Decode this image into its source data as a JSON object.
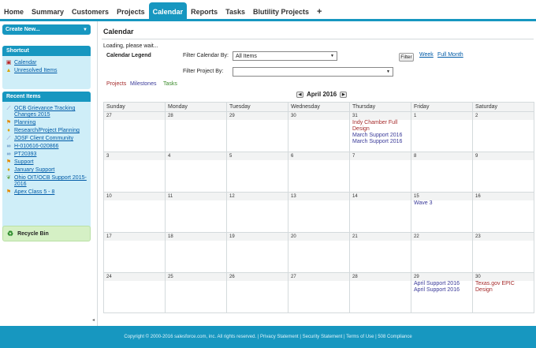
{
  "tabs": [
    {
      "label": "Home",
      "active": false
    },
    {
      "label": "Summary",
      "active": false
    },
    {
      "label": "Customers",
      "active": false
    },
    {
      "label": "Projects",
      "active": false
    },
    {
      "label": "Calendar",
      "active": true
    },
    {
      "label": "Reports",
      "active": false
    },
    {
      "label": "Tasks",
      "active": false
    },
    {
      "label": "Blutility Projects",
      "active": false
    },
    {
      "label": "+",
      "active": false
    }
  ],
  "sidebar": {
    "create_label": "Create New...",
    "shortcut": {
      "title": "Shortcut",
      "items": [
        {
          "label": "Calendar",
          "icon": "calendar-icon"
        },
        {
          "label": "Unresolved Items",
          "icon": "warning-icon"
        }
      ]
    },
    "recent": {
      "title": "Recent Items",
      "items": [
        {
          "label": "OCB Grievance Tracking Changes 2015",
          "icon": "wand-icon"
        },
        {
          "label": "Planning",
          "icon": "flag-icon"
        },
        {
          "label": "Research/Project Planning",
          "icon": "trophy-icon"
        },
        {
          "label": "JOSF Client Community",
          "icon": "wand-icon"
        },
        {
          "label": "H-010616-020866",
          "icon": "link-icon"
        },
        {
          "label": "PT20393",
          "icon": "link-icon"
        },
        {
          "label": "Support",
          "icon": "flag-icon"
        },
        {
          "label": "January Support",
          "icon": "trophy-icon"
        },
        {
          "label": "Ohio OIT/OCB Support 2015-2016",
          "icon": "leaf-icon"
        },
        {
          "label": "Apex Class 5 - 8",
          "icon": "flag-icon"
        }
      ]
    },
    "recycle_label": "Recycle Bin"
  },
  "main": {
    "title": "Calendar",
    "loading": "Loading, please wait...",
    "legend_label": "Calendar Legend",
    "filter_cal_label": "Filter Calendar By:",
    "filter_cal_value": "All Items",
    "filter_button": "Filter",
    "week_link": "Week",
    "full_month_link": "Full Month",
    "filter_project_label": "Filter Project By:",
    "filter_project_value": "",
    "legend": {
      "projects": "Projects",
      "milestones": "Milestones",
      "tasks": "Tasks"
    },
    "month_label": "April 2016",
    "days": [
      "Sunday",
      "Monday",
      "Tuesday",
      "Wednesday",
      "Thursday",
      "Friday",
      "Saturday"
    ],
    "weeks": [
      [
        {
          "num": "27",
          "events": []
        },
        {
          "num": "28",
          "events": []
        },
        {
          "num": "29",
          "events": []
        },
        {
          "num": "30",
          "events": []
        },
        {
          "num": "31",
          "events": [
            {
              "text": "Indy Chamber Full Design",
              "kind": "proj"
            },
            {
              "text": "March Support 2016",
              "kind": "mile"
            },
            {
              "text": "March Support 2016",
              "kind": "mile"
            }
          ]
        },
        {
          "num": "1",
          "events": []
        },
        {
          "num": "2",
          "events": []
        }
      ],
      [
        {
          "num": "3",
          "events": []
        },
        {
          "num": "4",
          "events": []
        },
        {
          "num": "5",
          "events": []
        },
        {
          "num": "6",
          "events": []
        },
        {
          "num": "7",
          "events": []
        },
        {
          "num": "8",
          "events": []
        },
        {
          "num": "9",
          "events": []
        }
      ],
      [
        {
          "num": "10",
          "events": []
        },
        {
          "num": "11",
          "events": []
        },
        {
          "num": "12",
          "events": []
        },
        {
          "num": "13",
          "events": []
        },
        {
          "num": "14",
          "events": []
        },
        {
          "num": "15",
          "events": [
            {
              "text": "Wave 3",
              "kind": "mile"
            }
          ]
        },
        {
          "num": "16",
          "events": []
        }
      ],
      [
        {
          "num": "17",
          "events": []
        },
        {
          "num": "18",
          "events": []
        },
        {
          "num": "19",
          "events": []
        },
        {
          "num": "20",
          "events": []
        },
        {
          "num": "21",
          "events": []
        },
        {
          "num": "22",
          "events": []
        },
        {
          "num": "23",
          "events": []
        }
      ],
      [
        {
          "num": "24",
          "events": []
        },
        {
          "num": "25",
          "events": []
        },
        {
          "num": "26",
          "events": []
        },
        {
          "num": "27",
          "events": []
        },
        {
          "num": "28",
          "events": []
        },
        {
          "num": "29",
          "events": [
            {
              "text": "April Support 2016",
              "kind": "mile"
            },
            {
              "text": "April Support 2016",
              "kind": "mile"
            }
          ]
        },
        {
          "num": "30",
          "events": [
            {
              "text": "Texas.gov EPIC Design",
              "kind": "proj"
            }
          ]
        }
      ]
    ]
  },
  "footer": "Copyright © 2000-2016 salesforce.com, inc. All rights reserved. | Privacy Statement | Security Statement | Terms of Use | 508 Compliance",
  "colors": {
    "accent": "#1797c0",
    "project": "#a52a2a",
    "milestone": "#3a3a99",
    "task": "#3a8a2a"
  }
}
